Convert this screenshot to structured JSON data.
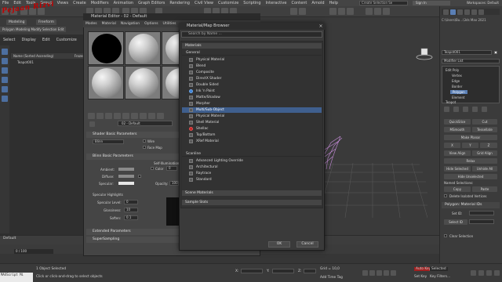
{
  "app": {
    "menu": [
      "File",
      "Edit",
      "Tools",
      "Group",
      "Views",
      "Create",
      "Modifiers",
      "Animation",
      "Graph Editors",
      "Rendering",
      "Civil View",
      "Customize",
      "Scripting",
      "Interactive",
      "Content",
      "Arnold",
      "Help"
    ],
    "search_placeholder": "Create Selection Se",
    "sign_in": "Sign In",
    "workspace_label": "Workspaces: Default",
    "path": "C:\\Users\\Bu...\\3ds Max 2021"
  },
  "ribbon": {
    "tab_modeling": "Modeling",
    "tab_freeform": "Freeform",
    "sub_label": "Polygon Modeling",
    "sub_tail": "Modify Selection   Edit"
  },
  "watermark": "Pejaan Rizvi",
  "explorer": {
    "tabs": [
      "Select",
      "Display",
      "Edit",
      "Customize"
    ],
    "column_header": "Name (Sorted Ascending)",
    "column_right": "Frozen",
    "row_item": "Teapot001"
  },
  "command_panel": {
    "object_name": "Teapot001",
    "modifier_list": "Modifier List",
    "modifiers": [
      "Edit Poly",
      "Vertex",
      "Edge",
      "Border",
      "Polygon",
      "Element",
      "Teapot"
    ],
    "selected_modifier": "Polygon",
    "buttons": {
      "quickslice": "QuickSlice",
      "cut": "Cut",
      "msmooth": "MSmooth",
      "tessellate": "Tessellate",
      "make_planar": "Make Planar",
      "x": "X",
      "y": "Y",
      "z": "Z",
      "view_align": "View Align",
      "grid_align": "Grid Align",
      "relax": "Relax",
      "hide_selected": "Hide Selected",
      "unhide_all": "Unhide All",
      "hide_unselected": "Hide Unselected",
      "copy": "Copy",
      "paste": "Paste"
    },
    "named_selections": "Named Selections:",
    "delete_isolated": "Delete Isolated Vertices",
    "section_matid": "Polygon: Material IDs",
    "set_id": "Set ID:",
    "select_id": "Select ID",
    "clear_selection": "Clear Selection"
  },
  "material_editor": {
    "title": "Material Editor - 02 - Default",
    "menu": [
      "Modes",
      "Material",
      "Navigation",
      "Options",
      "Utilities"
    ],
    "material_name": "02 - Default",
    "shader_section": "Shader Basic Parameters",
    "shader_type": "Blinn",
    "wire": "Wire",
    "two_sided": "2-Sided",
    "face_map": "Face Map",
    "faceted": "Faceted",
    "blinn_section": "Blinn Basic Parameters",
    "self_illum": "Self-Illumination",
    "color_label": "Color",
    "color_value": "0",
    "ambient": "Ambient:",
    "diffuse": "Diffuse:",
    "specular": "Specular:",
    "opacity": "Opacity:",
    "opacity_value": "100",
    "spec_highlights": "Specular Highlights",
    "specular_level": "Specular Level:",
    "specular_level_value": "0",
    "glossiness": "Glossiness:",
    "glossiness_value": "10",
    "soften": "Soften:",
    "soften_value": "0.1",
    "extended_section": "Extended Parameters",
    "supersampling_section": "SuperSampling"
  },
  "browser": {
    "title": "Material/Map Browser",
    "search_placeholder": "Search by Name ...",
    "group_materials": "Materials",
    "sub_general": "General",
    "general_items": [
      {
        "label": "Physical Material",
        "icon": "sphere"
      },
      {
        "label": "Blend",
        "icon": "sphere"
      },
      {
        "label": "Composite",
        "icon": "sphere"
      },
      {
        "label": "DirectX Shader",
        "icon": "sphere"
      },
      {
        "label": "Double Sided",
        "icon": "sphere"
      },
      {
        "label": "Ink 'n Paint",
        "icon": "blue"
      },
      {
        "label": "Matte/Shadow",
        "icon": "sphere"
      },
      {
        "label": "Morpher",
        "icon": "sphere"
      },
      {
        "label": "Multi/Sub-Object",
        "icon": "sphere"
      },
      {
        "label": "Physical Material",
        "icon": "sphere"
      },
      {
        "label": "Shell Material",
        "icon": "sphere"
      },
      {
        "label": "Shellac",
        "icon": "red"
      },
      {
        "label": "Top/Bottom",
        "icon": "sphere"
      },
      {
        "label": "XRef Material",
        "icon": "sphere"
      }
    ],
    "selected_index": 8,
    "sub_scanline": "Scanline",
    "scanline_items": [
      "Advanced Lighting Override",
      "Architectural",
      "Raytrace",
      "Standard"
    ],
    "group_scene": "Scene Materials",
    "group_sample": "Sample Slots",
    "ok": "OK",
    "cancel": "Cancel"
  },
  "timeline": {
    "frame_readout": "0 / 100",
    "default_label": "Default"
  },
  "status": {
    "selected": "1 Object Selected",
    "hint": "Click or click-and-drag to select objects",
    "maxscript": "MAXScript Mi",
    "x_label": "X:",
    "y_label": "Y:",
    "z_label": "Z:",
    "grid": "Grid = 10,0",
    "add_time_tag": "Add Time Tag",
    "autokey": "Auto Key",
    "selected_dd": "Selected",
    "set_key": "Set Key",
    "key_filters": "Key Filters..."
  }
}
